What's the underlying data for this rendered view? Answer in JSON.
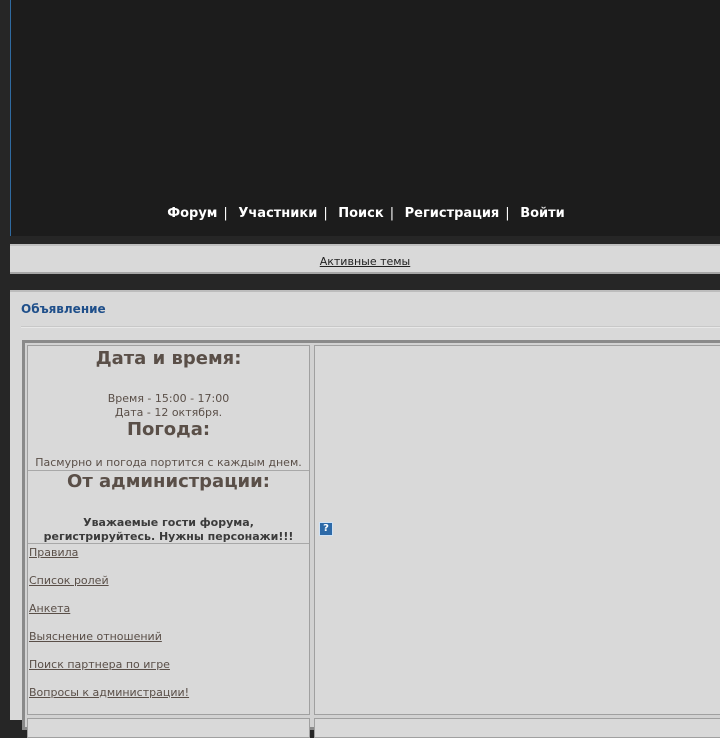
{
  "nav": {
    "items": [
      "Форум",
      "Участники",
      "Поиск",
      "Регистрация",
      "Войти"
    ]
  },
  "bar": {
    "active_topics": "Активные темы"
  },
  "announcement": {
    "title": "Объявление",
    "datetime_heading": "Дата и время:",
    "time_line": "Время - 15:00 - 17:00",
    "date_line": "Дата - 12 октября.",
    "weather_heading": "Погода:",
    "weather_text": "Пасмурно и погода портится с каждым днем.",
    "admin_heading": "От администрации:",
    "admin_text_1": "Уважаемые гости форума,",
    "admin_text_2": "регистрируйтесь. Нужны персонажи!!!",
    "links": [
      "Правила",
      "Список ролей",
      "Анкета",
      "Выяснение отношений",
      "Поиск партнера по игре",
      "Вопросы к администрации!"
    ],
    "help_icon": "?"
  }
}
